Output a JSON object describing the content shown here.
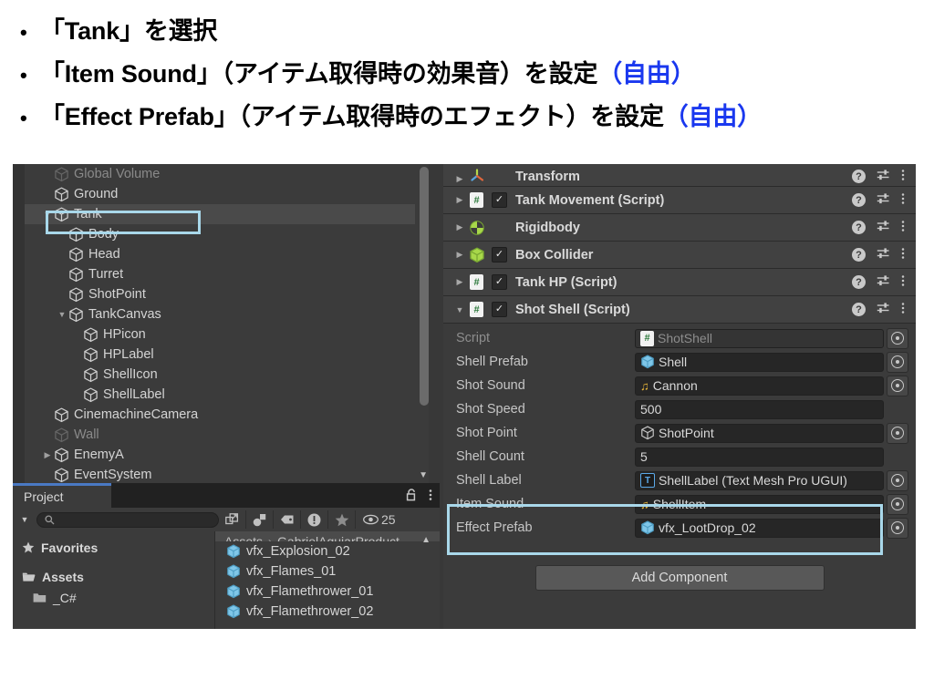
{
  "slide": {
    "bullets": [
      {
        "text": "「Tank」を選択",
        "suffix": "",
        "suffix_color": ""
      },
      {
        "text": "「Item Sound」（アイテム取得時の効果音）を設定",
        "suffix": "（自由）",
        "suffix_color": "#1a38ef"
      },
      {
        "text": "「Effect Prefab」（アイテム取得時のエフェクト）を設定",
        "suffix": "（自由）",
        "suffix_color": "#1a38ef"
      }
    ],
    "bullet_marker": "•"
  },
  "colors": {
    "highlight_box": "#a9d8ea",
    "panel_bg": "#3b3b3b",
    "component_header_bg": "#414141",
    "field_bg": "#262626",
    "accent_blue": "#1a38ef",
    "tab_accent": "#4a79c4"
  },
  "hierarchy": {
    "items": [
      {
        "label": "Global Volume",
        "indent": 2,
        "arrow": "",
        "dim": true,
        "selected": false
      },
      {
        "label": "Ground",
        "indent": 2,
        "arrow": "",
        "dim": false,
        "selected": false
      },
      {
        "label": "Tank",
        "indent": 2,
        "arrow": "▼",
        "dim": false,
        "selected": true
      },
      {
        "label": "Body",
        "indent": 3,
        "arrow": "",
        "dim": false,
        "selected": false
      },
      {
        "label": "Head",
        "indent": 3,
        "arrow": "",
        "dim": false,
        "selected": false
      },
      {
        "label": "Turret",
        "indent": 3,
        "arrow": "",
        "dim": false,
        "selected": false
      },
      {
        "label": "ShotPoint",
        "indent": 3,
        "arrow": "",
        "dim": false,
        "selected": false
      },
      {
        "label": "TankCanvas",
        "indent": 3,
        "arrow": "▼",
        "dim": false,
        "selected": false
      },
      {
        "label": "HPicon",
        "indent": 4,
        "arrow": "",
        "dim": false,
        "selected": false
      },
      {
        "label": "HPLabel",
        "indent": 4,
        "arrow": "",
        "dim": false,
        "selected": false
      },
      {
        "label": "ShellIcon",
        "indent": 4,
        "arrow": "",
        "dim": false,
        "selected": false
      },
      {
        "label": "ShellLabel",
        "indent": 4,
        "arrow": "",
        "dim": false,
        "selected": false
      },
      {
        "label": "CinemachineCamera",
        "indent": 2,
        "arrow": "",
        "dim": false,
        "selected": false
      },
      {
        "label": "Wall",
        "indent": 2,
        "arrow": "",
        "dim": true,
        "selected": false
      },
      {
        "label": "EnemyA",
        "indent": 2,
        "arrow": "▶",
        "dim": false,
        "selected": false
      },
      {
        "label": "EventSystem",
        "indent": 2,
        "arrow": "",
        "dim": false,
        "selected": false
      }
    ]
  },
  "project": {
    "tab_label": "Project",
    "lock_icon": "lock-open-icon",
    "menu_icon": "kebab-menu-icon",
    "search_placeholder": "",
    "search_value": "",
    "toolbar_icons": [
      "search-icon",
      "expand-window-icon",
      "type-filter-icon",
      "label-filter-icon",
      "warning-filter-icon",
      "favorite-star-icon",
      "visibility-eye-icon"
    ],
    "visibility_count": "25",
    "left_tree": [
      {
        "label": "Favorites",
        "icon": "star-icon",
        "indent": 0
      },
      {
        "label": "Assets",
        "icon": "assets-icon",
        "indent": 0
      },
      {
        "label": "_C#",
        "icon": "folder-icon",
        "indent": 1
      }
    ],
    "breadcrumb": [
      "Assets",
      "GabrielAguiarProduct"
    ],
    "breadcrumb_separator": "›",
    "assets": [
      {
        "label": "vfx_Explosion_02",
        "icon": "prefab-cube-icon",
        "clipped": "top"
      },
      {
        "label": "vfx_Flames_01",
        "icon": "prefab-cube-icon",
        "clipped": ""
      },
      {
        "label": "vfx_Flamethrower_01",
        "icon": "prefab-cube-icon",
        "clipped": ""
      },
      {
        "label": "vfx_Flamethrower_02",
        "icon": "prefab-cube-icon",
        "clipped": "bottom"
      }
    ]
  },
  "inspector": {
    "components": [
      {
        "name": "Transform",
        "icon": "transform-axis-icon",
        "arrow": "▶",
        "has_checkbox": false,
        "checked": false
      },
      {
        "name": "Tank Movement (Script)",
        "icon": "csharp-script-icon",
        "arrow": "▶",
        "has_checkbox": true,
        "checked": true
      },
      {
        "name": "Rigidbody",
        "icon": "rigidbody-icon",
        "arrow": "▶",
        "has_checkbox": false,
        "checked": false
      },
      {
        "name": "Box Collider",
        "icon": "box-collider-icon",
        "arrow": "▶",
        "has_checkbox": true,
        "checked": true
      },
      {
        "name": "Tank HP (Script)",
        "icon": "csharp-script-icon",
        "arrow": "▶",
        "has_checkbox": true,
        "checked": true
      },
      {
        "name": "Shot Shell (Script)",
        "icon": "csharp-script-icon",
        "arrow": "▼",
        "has_checkbox": true,
        "checked": true
      }
    ],
    "component_row_icons": {
      "help": "help-icon",
      "preset": "preset-icon",
      "menu": "kebab-menu-icon"
    },
    "properties": [
      {
        "label": "Script",
        "value": "ShotShell",
        "value_icon": "csharp-script-icon",
        "picker": true,
        "disabled": true,
        "highlighted": false
      },
      {
        "label": "Shell Prefab",
        "value": "Shell",
        "value_icon": "prefab-cube-icon",
        "picker": true,
        "disabled": false,
        "highlighted": false
      },
      {
        "label": "Shot Sound",
        "value": "Cannon",
        "value_icon": "audio-clip-icon",
        "picker": true,
        "disabled": false,
        "highlighted": false
      },
      {
        "label": "Shot Speed",
        "value": "500",
        "value_icon": "",
        "picker": false,
        "disabled": false,
        "highlighted": false
      },
      {
        "label": "Shot Point",
        "value": "ShotPoint",
        "value_icon": "gameobject-icon",
        "picker": true,
        "disabled": false,
        "highlighted": false
      },
      {
        "label": "Shell Count",
        "value": "5",
        "value_icon": "",
        "picker": false,
        "disabled": false,
        "highlighted": false
      },
      {
        "label": "Shell Label",
        "value": "ShellLabel (Text Mesh Pro UGUI)",
        "value_icon": "textmeshpro-icon",
        "picker": true,
        "disabled": false,
        "highlighted": false
      },
      {
        "label": "Item Sound",
        "value": "ShellItem",
        "value_icon": "audio-clip-icon",
        "picker": true,
        "disabled": false,
        "highlighted": true
      },
      {
        "label": "Effect Prefab",
        "value": "vfx_LootDrop_02",
        "value_icon": "prefab-cube-icon",
        "picker": true,
        "disabled": false,
        "highlighted": true
      }
    ],
    "add_component_label": "Add Component"
  }
}
